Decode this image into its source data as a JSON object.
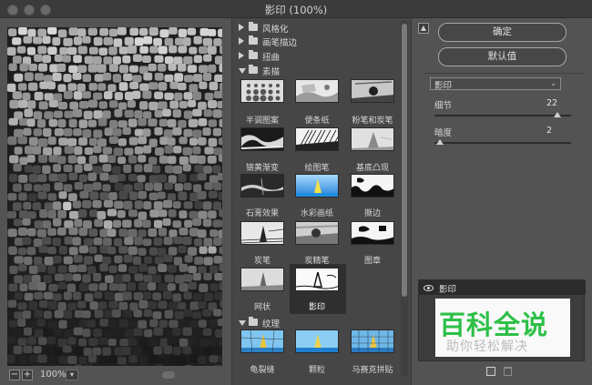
{
  "window": {
    "title": "影印 (100%)"
  },
  "preview": {
    "zoom": "100%",
    "zoom_in": "+",
    "zoom_out": "−"
  },
  "gallery": {
    "categories": [
      {
        "label": "风格化",
        "expanded": false
      },
      {
        "label": "画笔描边",
        "expanded": false
      },
      {
        "label": "扭曲",
        "expanded": false
      },
      {
        "label": "素描",
        "expanded": true
      },
      {
        "label": "纹理",
        "expanded": true
      }
    ],
    "sketch_filters": [
      "半调图案",
      "便条纸",
      "粉笔和炭笔",
      "铬黄渐变",
      "绘图笔",
      "基底凸现",
      "石膏效果",
      "水彩画纸",
      "撕边",
      "炭笔",
      "炭精笔",
      "图章",
      "网状",
      "影印"
    ],
    "texture_filters": [
      "龟裂缝",
      "颗粒",
      "马赛克拼贴"
    ],
    "selected": "影印"
  },
  "buttons": {
    "ok": "确定",
    "default": "默认值"
  },
  "settings": {
    "filter_select": "影印",
    "params": [
      {
        "label": "细节",
        "value": "22",
        "fraction": 0.9
      },
      {
        "label": "暗度",
        "value": "2",
        "fraction": 0.04
      }
    ]
  },
  "layers": {
    "items": [
      {
        "name": "影印",
        "visible": true
      }
    ]
  },
  "watermark": {
    "line1": "百科全说",
    "line2": "助你轻松解决"
  }
}
